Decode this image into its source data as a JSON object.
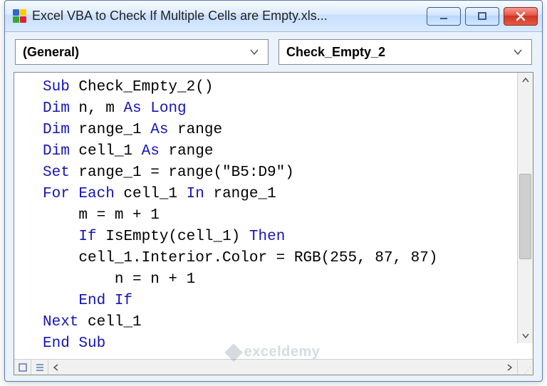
{
  "title": "Excel VBA to Check If Multiple Cells are  Empty.xls...",
  "dropdowns": {
    "left": "(General)",
    "right": "Check_Empty_2"
  },
  "code": {
    "tokens": [
      [
        [
          "kw",
          "Sub"
        ],
        [
          "",
          " Check_Empty_2()"
        ]
      ],
      [
        [
          "kw",
          "Dim"
        ],
        [
          "",
          " n, m "
        ],
        [
          "kw",
          "As Long"
        ]
      ],
      [
        [
          "kw",
          "Dim"
        ],
        [
          "",
          " range_1 "
        ],
        [
          "kw",
          "As"
        ],
        [
          "",
          " range"
        ]
      ],
      [
        [
          "kw",
          "Dim"
        ],
        [
          "",
          " cell_1 "
        ],
        [
          "kw",
          "As"
        ],
        [
          "",
          " range"
        ]
      ],
      [
        [
          "kw",
          "Set"
        ],
        [
          "",
          " range_1 = range(\"B5:D9\")"
        ]
      ],
      [
        [
          "kw",
          "For Each"
        ],
        [
          "",
          " cell_1 "
        ],
        [
          "kw",
          "In"
        ],
        [
          "",
          " range_1"
        ]
      ],
      [
        [
          "",
          "    m = m + 1"
        ]
      ],
      [
        [
          "",
          "    "
        ],
        [
          "kw",
          "If"
        ],
        [
          "",
          " IsEmpty(cell_1) "
        ],
        [
          "kw",
          "Then"
        ]
      ],
      [
        [
          "",
          "    cell_1.Interior.Color = RGB(255, 87, 87)"
        ]
      ],
      [
        [
          "",
          "        n = n + 1"
        ]
      ],
      [
        [
          "",
          "    "
        ],
        [
          "kw",
          "End If"
        ]
      ],
      [
        [
          "kw",
          "Next"
        ],
        [
          "",
          " cell_1"
        ]
      ],
      [
        [
          "kw",
          "End Sub"
        ]
      ]
    ]
  },
  "watermark": "exceldemy"
}
